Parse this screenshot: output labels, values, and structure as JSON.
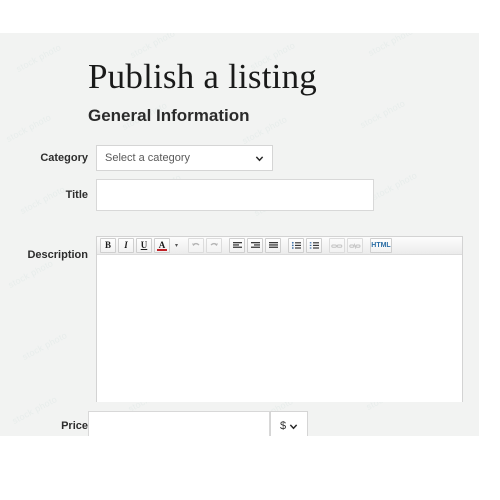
{
  "page": {
    "title": "Publish a listing",
    "section_title": "General Information",
    "accent_color": "#1b96c4",
    "panel_bg": "#f2f3f2",
    "watermark_text": "stock"
  },
  "form": {
    "category": {
      "label": "Category",
      "selected": "Select a category",
      "caret_icon": "chevron-down-icon"
    },
    "title": {
      "label": "Title",
      "value": "",
      "placeholder": ""
    },
    "description": {
      "label": "Description",
      "value": "",
      "toolbar": [
        {
          "name": "bold-button",
          "glyph": "B",
          "state": "enabled"
        },
        {
          "name": "italic-button",
          "glyph": "I",
          "state": "enabled"
        },
        {
          "name": "underline-button",
          "glyph": "U",
          "state": "enabled"
        },
        {
          "name": "text-color-button",
          "glyph": "A",
          "state": "enabled"
        },
        {
          "name": "text-color-caret",
          "glyph": "▾",
          "state": "enabled"
        },
        {
          "name": "undo-button",
          "glyph": "↶",
          "state": "disabled"
        },
        {
          "name": "redo-button",
          "glyph": "↷",
          "state": "disabled"
        },
        {
          "name": "align-left-button",
          "glyph": "≡",
          "state": "enabled"
        },
        {
          "name": "align-center-button",
          "glyph": "≡",
          "state": "enabled"
        },
        {
          "name": "align-right-button",
          "glyph": "≡",
          "state": "enabled"
        },
        {
          "name": "bullet-list-button",
          "glyph": "☰",
          "state": "enabled"
        },
        {
          "name": "numbered-list-button",
          "glyph": "☰",
          "state": "enabled"
        },
        {
          "name": "insert-link-button",
          "glyph": "⚭",
          "state": "disabled"
        },
        {
          "name": "remove-link-button",
          "glyph": "⚭",
          "state": "disabled"
        },
        {
          "name": "html-source-button",
          "glyph": "HTML",
          "state": "enabled"
        }
      ]
    },
    "price": {
      "label": "Price",
      "value": "",
      "placeholder": "",
      "currency": {
        "selected": "$",
        "caret_icon": "chevron-down-icon"
      }
    },
    "submit": {
      "label": ""
    }
  }
}
